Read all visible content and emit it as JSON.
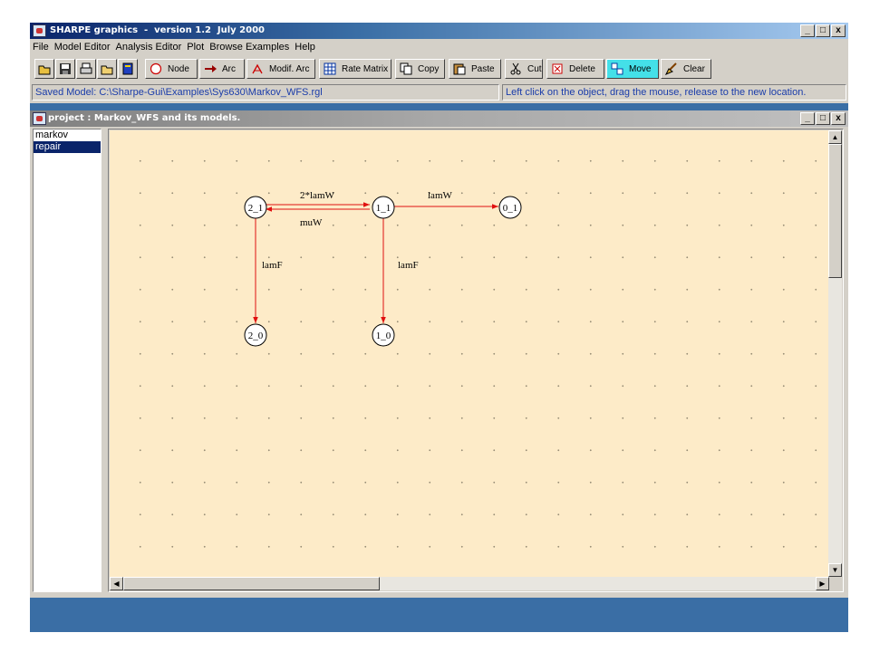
{
  "app": {
    "title": "SHARPE graphics  -  version 1.2  July 2000",
    "window_buttons": [
      "_",
      "□",
      "x"
    ]
  },
  "menu": [
    "File",
    "Model Editor",
    "Analysis Editor",
    "Plot",
    "Browse Examples",
    "Help"
  ],
  "toolbar": {
    "file_icons": [
      "open-folder-icon",
      "save-icon",
      "print-icon",
      "new-folder-icon",
      "book-icon"
    ],
    "node": "Node",
    "arc": "Arc",
    "modif_arc": "Modif. Arc",
    "rate_matrix": "Rate Matrix",
    "copy": "Copy",
    "paste": "Paste",
    "cut": "Cut",
    "delete": "Delete",
    "move": "Move",
    "clear": "Clear",
    "active_tool": "Move"
  },
  "status": {
    "saved_model": "Saved Model: C:\\Sharpe-Gui\\Examples\\Sys630\\Markov_WFS.rgl",
    "hint": "Left click on the object, drag the mouse, release to the new location."
  },
  "project": {
    "title": "project : Markov_WFS and its models.",
    "models": [
      "markov",
      "repair"
    ],
    "selected_model": "repair"
  },
  "graph": {
    "nodes": [
      "2_1",
      "1_1",
      "0_1",
      "2_0",
      "1_0"
    ],
    "arcs": [
      {
        "from": "2_1",
        "to": "1_1",
        "label": "2*lamW"
      },
      {
        "from": "1_1",
        "to": "2_1",
        "label": "muW"
      },
      {
        "from": "1_1",
        "to": "0_1",
        "label": "lamW"
      },
      {
        "from": "2_1",
        "to": "2_0",
        "label": "lamF"
      },
      {
        "from": "1_1",
        "to": "1_0",
        "label": "lamF"
      }
    ]
  },
  "colors": {
    "arc": "#e01010",
    "canvas": "#fdebc8",
    "active_tool": "#44e0e8",
    "status_text": "#1a3caa"
  }
}
